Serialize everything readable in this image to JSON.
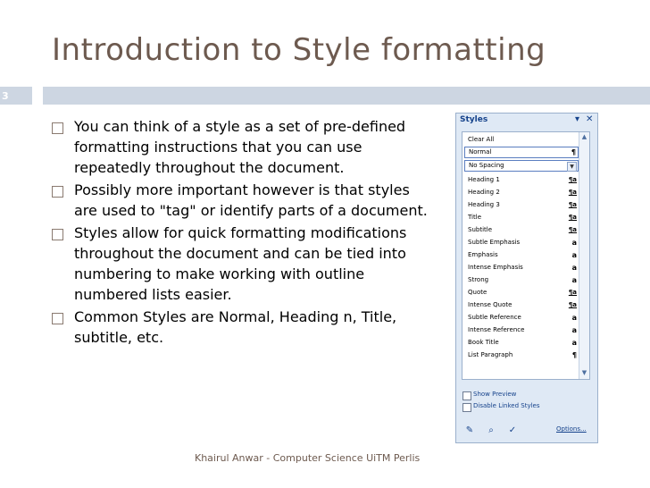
{
  "slide": {
    "title": "Introduction to Style formatting",
    "number": "3",
    "footer": "Khairul Anwar - Computer Science UiTM Perlis"
  },
  "bullets": [
    "You can think of a style as a set of pre-defined formatting instructions that you can use repeatedly throughout the document.",
    "Possibly more important however is that styles are used to \"tag\" or identify parts of a document.",
    "Styles allow for quick formatting modifications throughout the document and can be tied into numbering to make working with outline numbered lists easier.",
    "Common Styles are Normal, Heading n, Title, subtitle, etc."
  ],
  "styles_pane": {
    "title": "Styles",
    "items": [
      {
        "label": "Clear All",
        "mark": ""
      },
      {
        "label": "Normal",
        "mark": "¶"
      },
      {
        "label": "No Spacing",
        "mark": "¶"
      },
      {
        "label": "Heading 1",
        "mark": "¶a"
      },
      {
        "label": "Heading 2",
        "mark": "¶a"
      },
      {
        "label": "Heading 3",
        "mark": "¶a"
      },
      {
        "label": "Title",
        "mark": "¶a"
      },
      {
        "label": "Subtitle",
        "mark": "¶a"
      },
      {
        "label": "Subtle Emphasis",
        "mark": "a"
      },
      {
        "label": "Emphasis",
        "mark": "a"
      },
      {
        "label": "Intense Emphasis",
        "mark": "a"
      },
      {
        "label": "Strong",
        "mark": "a"
      },
      {
        "label": "Quote",
        "mark": "¶a"
      },
      {
        "label": "Intense Quote",
        "mark": "¶a"
      },
      {
        "label": "Subtle Reference",
        "mark": "a"
      },
      {
        "label": "Intense Reference",
        "mark": "a"
      },
      {
        "label": "Book Title",
        "mark": "a"
      },
      {
        "label": "List Paragraph",
        "mark": "¶"
      }
    ],
    "show_preview": "Show Preview",
    "disable_linked": "Disable Linked Styles",
    "options": "Options...",
    "colors": {
      "accent": "#15428b",
      "pane_bg": "#dfe9f5",
      "title_color": "#6d5a4f",
      "bar": "#cdd6e2"
    }
  }
}
